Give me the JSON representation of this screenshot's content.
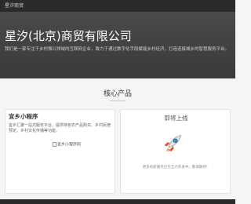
{
  "topbar": {
    "brand": "星汐商贸"
  },
  "hero": {
    "title": "星汐(北京)商贸有限公司",
    "subtitle": "我们是一家专注于乡村振兴领域的互联网企业，致力于通过数字化手段赋能乡村经济，打造连接城乡的智慧服务平台。"
  },
  "section": {
    "title": "核心产品"
  },
  "products": {
    "left": {
      "title": "宜乡小程序",
      "description": "宜乡汇聚一站式服务平台，提供特色农产品购买、乡村民宿预定、乡村文化传播等功能。",
      "image_alt": "宜乡小程序码"
    },
    "right": {
      "title": "即将上线",
      "description": "更多创新服务正在全力开发中，敬请期待！"
    }
  }
}
